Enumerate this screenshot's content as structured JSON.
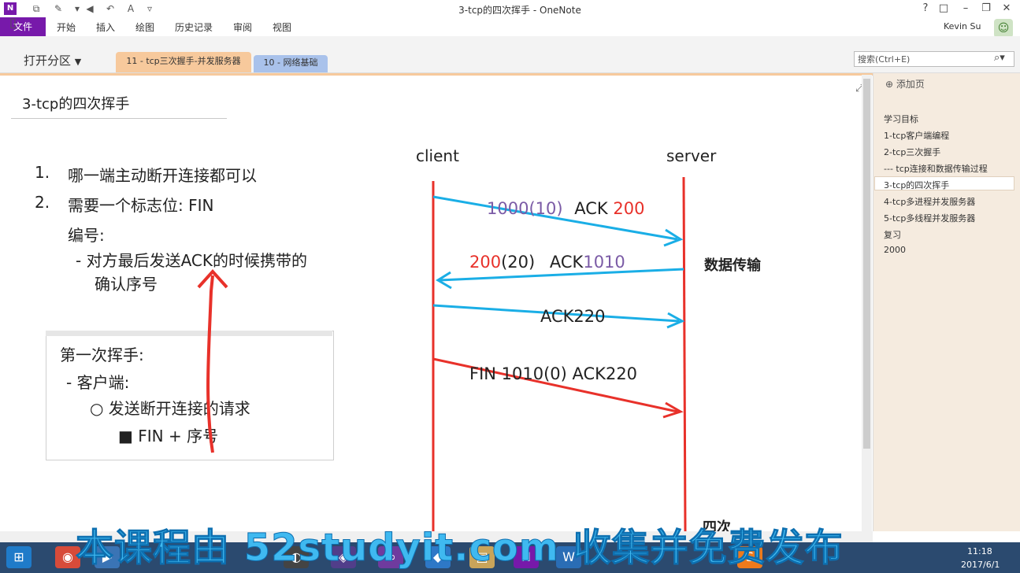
{
  "window": {
    "title": "3-tcp的四次挥手 - OneNote",
    "user_name": "Kevin Su",
    "controls": {
      "help": "?",
      "restore": "□",
      "minimize": "–",
      "maximize": "❐",
      "close": "✕"
    }
  },
  "ribbon": {
    "tabs": [
      "文件",
      "开始",
      "插入",
      "绘图",
      "历史记录",
      "审阅",
      "视图"
    ]
  },
  "notebook": {
    "open_section_label": "打开分区",
    "section_tabs": [
      "11 - tcp三次握手-并发服务器",
      "10 - 网络基础"
    ],
    "search_placeholder": "搜索(Ctrl+E)"
  },
  "page": {
    "title": "3-tcp的四次挥手",
    "list_items": [
      {
        "num": "1.",
        "text": "哪一端主动断开连接都可以"
      },
      {
        "num": "2.",
        "text": "需要一个标志位: FIN"
      }
    ],
    "sub_heading": "编号:",
    "dash_item_line1": "- 对方最后发送ACK的时候携带的",
    "dash_item_line2": "确认序号",
    "callout": {
      "heading": "第一次挥手:",
      "line1": "- 客户端:",
      "line2": "○ 发送断开连接的请求",
      "line3": "■ FIN + 序号"
    }
  },
  "diagram": {
    "client_label": "client",
    "server_label": "server",
    "msg1_seq": "1000(10)",
    "msg1_ack": "ACK",
    "msg1_ack_num": "200",
    "msg2_seq": "200",
    "msg2_len": "(20)",
    "msg2_ack": "ACK",
    "msg2_ack_num": "1010",
    "msg3": "ACK220",
    "msg4": "FIN 1010(0) ACK220",
    "phase_label": "数据传输",
    "bottom_label": "四次"
  },
  "pagelist": {
    "add_page": "添加页",
    "items": [
      "学习目标",
      "1-tcp客户端编程",
      "2-tcp三次握手",
      "--- tcp连接和数据传输过程",
      "3-tcp的四次挥手",
      "4-tcp多进程并发服务器",
      "5-tcp多线程并发服务器",
      "复习",
      "2000"
    ],
    "selected_index": 4
  },
  "taskbar": {
    "time": "11:18",
    "date": "2017/6/1"
  },
  "watermark": "本课程由 52studyit.com 收集并免费发布",
  "colors": {
    "onenote_purple": "#7719aa",
    "section_tab_orange": "#f7c99c",
    "section_tab_blue": "#a9c2eb",
    "arrow_blue": "#1aaee6",
    "arrow_red": "#e8312a",
    "ack_purple": "#7b5ba6",
    "watermark_blue": "#3fb9f0"
  }
}
